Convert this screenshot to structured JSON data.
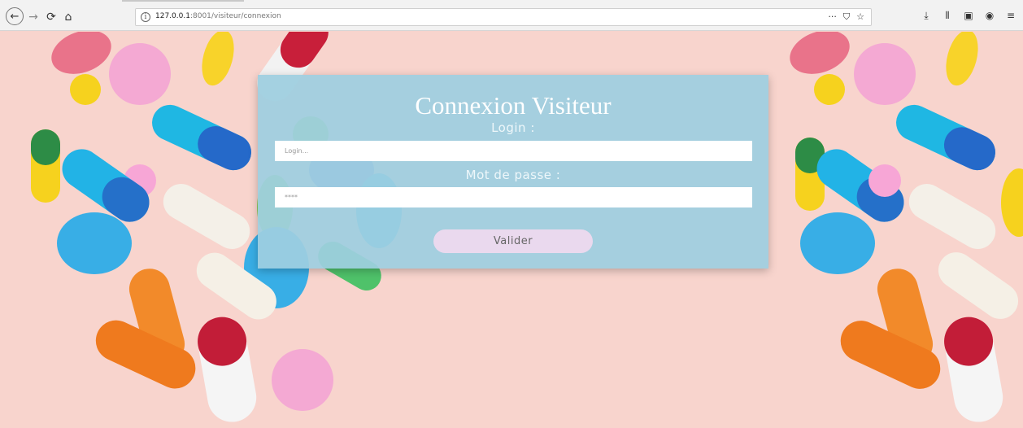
{
  "browser": {
    "url_host": "127.0.0.1",
    "url_rest": ":8001/visiteur/connexion",
    "icons": {
      "back": "←",
      "forward": "→",
      "reload": "⟳",
      "home": "⌂",
      "info": "i",
      "more": "···",
      "pocket": "⛉",
      "bookmark": "☆",
      "download": "⤓",
      "library": "⫴",
      "sidebar": "▣",
      "account": "◉",
      "menu": "≡"
    }
  },
  "form": {
    "title": "Connexion Visiteur",
    "login_label": "Login :",
    "login_placeholder": "Login...",
    "password_label": "Mot de passe :",
    "password_placeholder": "****",
    "submit_label": "Valider"
  },
  "colors": {
    "page_bg": "#f8d4cd",
    "panel_bg": "#9ecfe0",
    "button_bg": "#ead9ee"
  }
}
